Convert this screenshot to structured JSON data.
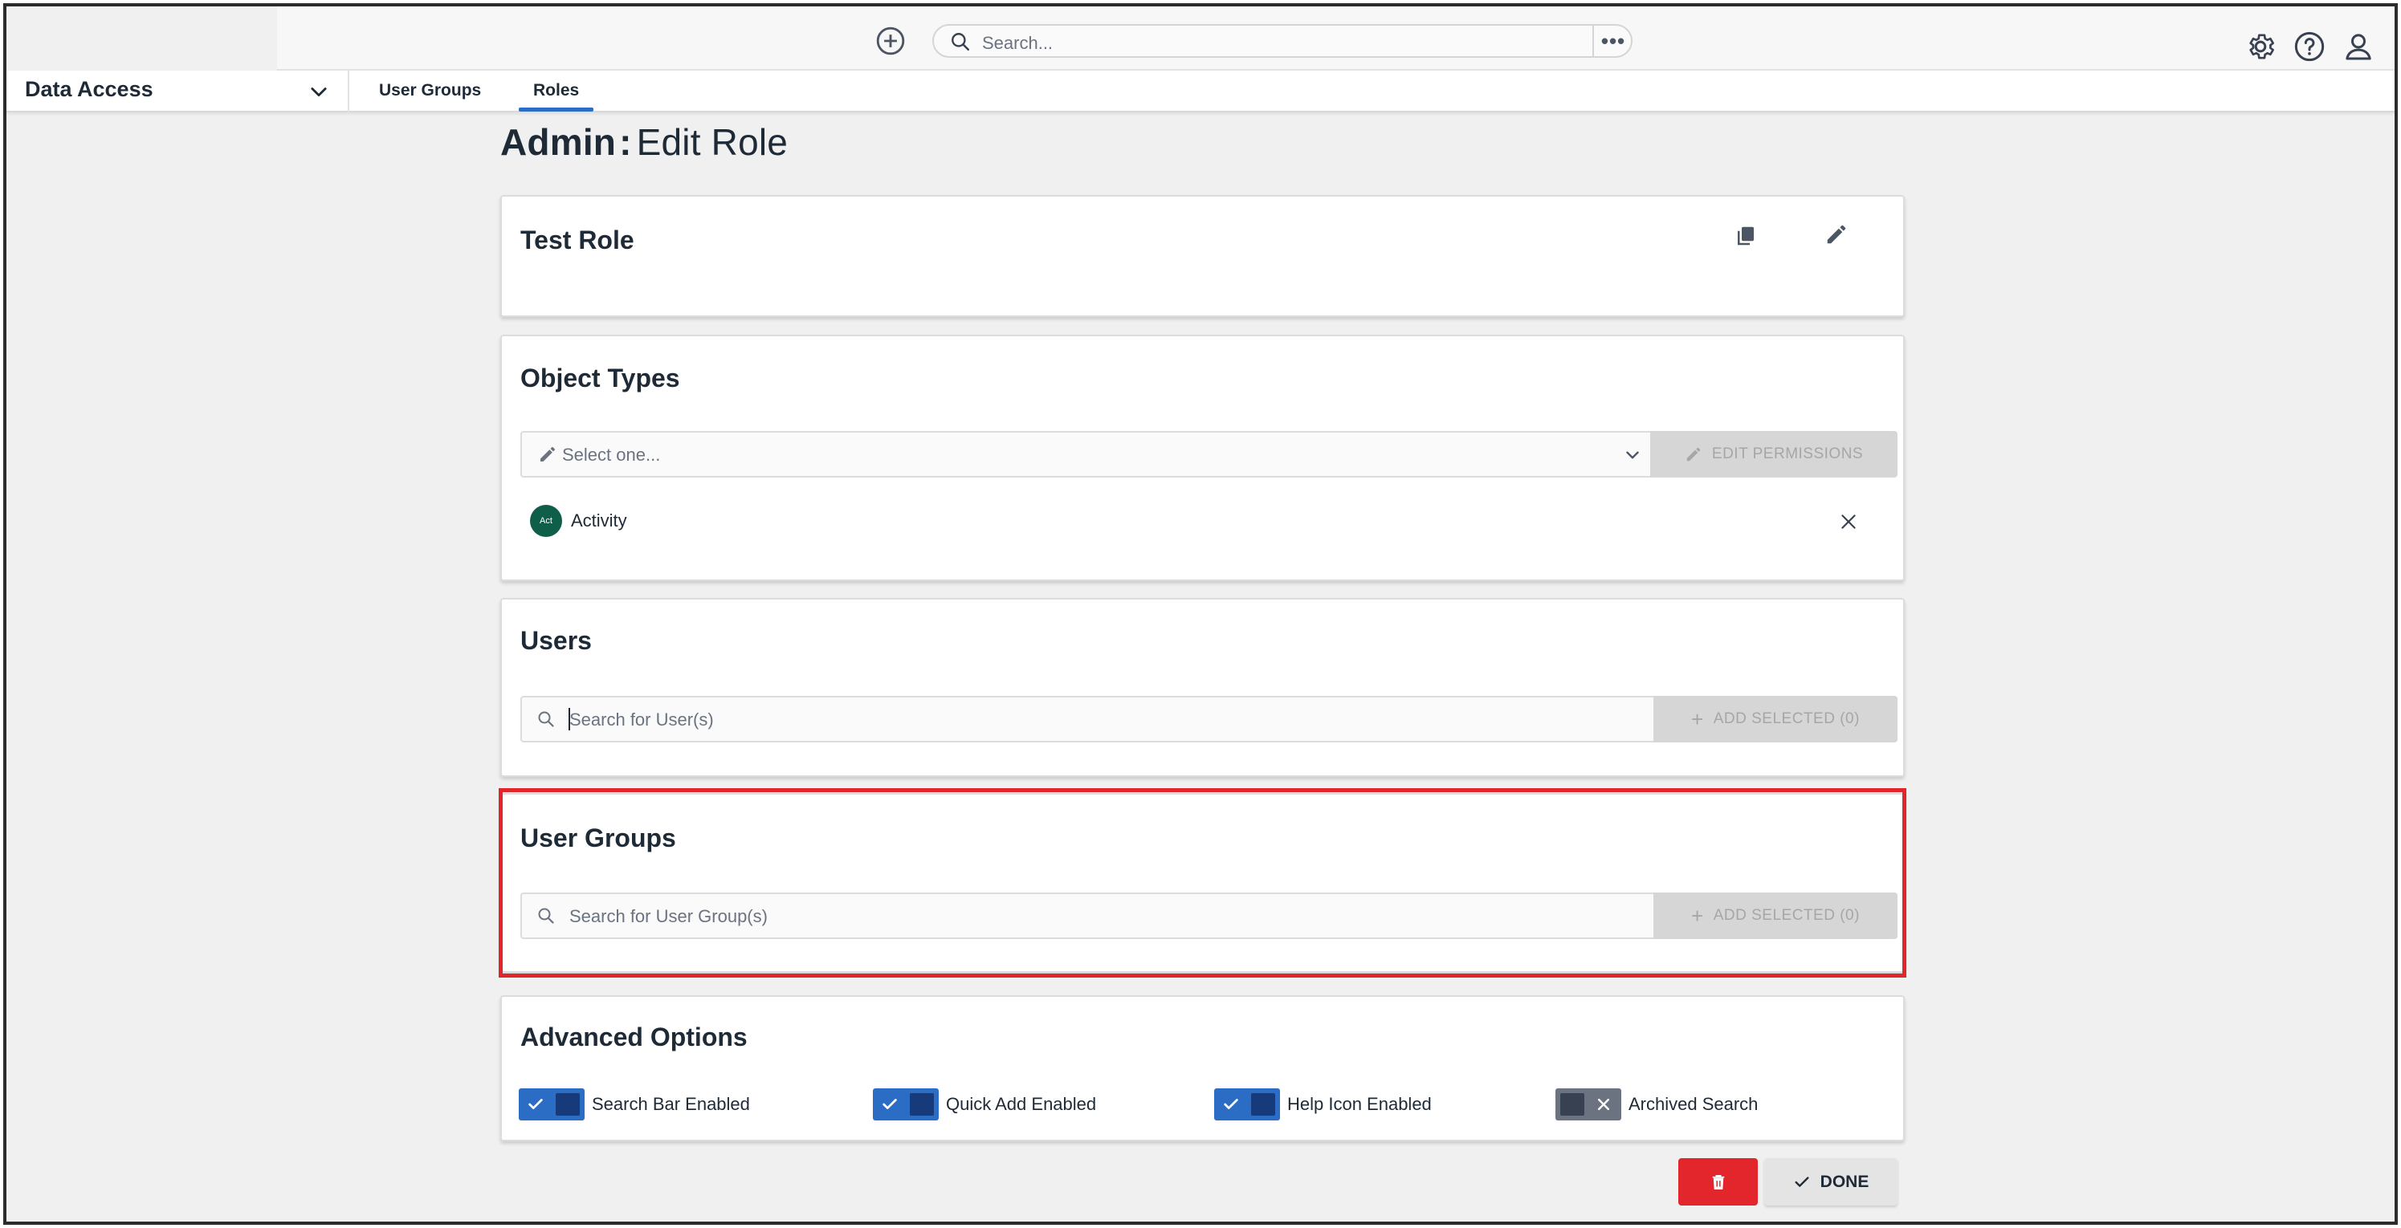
{
  "header": {
    "search_placeholder": "Search...",
    "more_label": "•••",
    "icons": [
      "add-circle-icon",
      "search-icon",
      "gear-icon",
      "help-icon",
      "user-icon"
    ]
  },
  "nav": {
    "app_name": "Data Access",
    "tabs": [
      {
        "label": "User Groups",
        "active": false
      },
      {
        "label": "Roles",
        "active": true
      }
    ]
  },
  "page": {
    "title_prefix": "Admin",
    "title_separator": ":",
    "title_suffix": "Edit Role"
  },
  "role_card": {
    "name": "Test Role",
    "icons": [
      "copy-icon",
      "pencil-icon"
    ]
  },
  "object_types": {
    "title": "Object Types",
    "select_placeholder": "Select one...",
    "edit_button": "EDIT PERMISSIONS",
    "items": [
      {
        "badge": "Act",
        "label": "Activity",
        "badge_color": "#0f5e4a"
      }
    ]
  },
  "users": {
    "title": "Users",
    "search_placeholder": "Search for User(s)",
    "add_button": "ADD SELECTED (0)"
  },
  "user_groups": {
    "title": "User Groups",
    "search_placeholder": "Search for User Group(s)",
    "add_button": "ADD SELECTED (0)"
  },
  "advanced": {
    "title": "Advanced Options",
    "options": [
      {
        "label": "Search Bar Enabled",
        "on": true
      },
      {
        "label": "Quick Add Enabled",
        "on": true
      },
      {
        "label": "Help Icon Enabled",
        "on": true
      },
      {
        "label": "Archived Search",
        "on": false
      }
    ]
  },
  "footer": {
    "done_label": "DONE"
  },
  "colors": {
    "accent": "#2b6cc4",
    "danger": "#e3262b",
    "toggle_on": "#2b6cc4",
    "toggle_off": "#6b7280",
    "highlight": "#e0262a"
  }
}
